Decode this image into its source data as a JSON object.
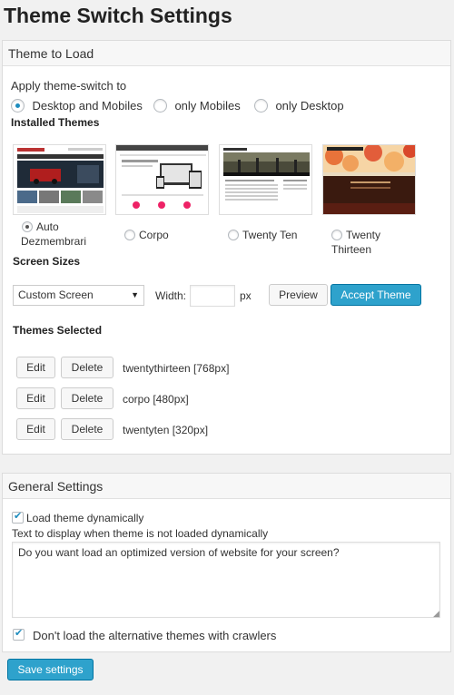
{
  "page": {
    "title": "Theme Switch Settings"
  },
  "theme_box": {
    "title": "Theme to Load",
    "apply_label": "Apply theme-switch to",
    "apply_options": [
      "Desktop and Mobiles",
      "only Mobiles",
      "only Desktop"
    ],
    "apply_selected": "Desktop and Mobiles",
    "installed_label": "Installed Themes",
    "themes": [
      {
        "label_line1": "Auto",
        "label_line2": "Dezmembrari",
        "selected": true
      },
      {
        "label_line1": "Corpo",
        "label_line2": "",
        "selected": false
      },
      {
        "label_line1": "Twenty Ten",
        "label_line2": "",
        "selected": false
      },
      {
        "label_line1": "Twenty",
        "label_line2": "Thirteen",
        "selected": false
      }
    ],
    "screen_sizes_label": "Screen Sizes",
    "screen_select_value": "Custom Screen",
    "width_label": "Width:",
    "width_value": "",
    "px_label": "px",
    "preview_button": "Preview",
    "accept_button": "Accept Theme",
    "selected_label": "Themes Selected",
    "selected_rows": [
      {
        "edit": "Edit",
        "delete": "Delete",
        "text": "twentythirteen [768px]"
      },
      {
        "edit": "Edit",
        "delete": "Delete",
        "text": "corpo [480px]"
      },
      {
        "edit": "Edit",
        "delete": "Delete",
        "text": "twentyten [320px]"
      }
    ]
  },
  "general_box": {
    "title": "General Settings",
    "load_dynamic_label": "Load theme dynamically",
    "load_dynamic_checked": true,
    "text_display_label": "Text to display when theme is not loaded dynamically",
    "textarea_value": "Do you want load an optimized version of website for your screen?",
    "crawlers_label": "Don't load the alternative themes with crawlers",
    "crawlers_checked": true
  },
  "save_button": "Save settings",
  "colors": {
    "primary": "#2ea2cc",
    "primary_border": "#0074a2",
    "radio_dot": "#1e8cbe"
  }
}
